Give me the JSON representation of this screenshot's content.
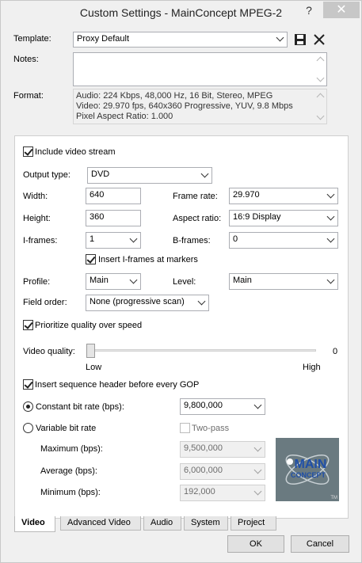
{
  "window": {
    "title": "Custom Settings - MainConcept MPEG-2"
  },
  "titlebar": {
    "help": "?",
    "close": "✕"
  },
  "template": {
    "label": "Template:",
    "value": "Proxy Default"
  },
  "notes": {
    "label": "Notes:",
    "value": ""
  },
  "format": {
    "label": "Format:",
    "lines": [
      "Audio: 224 Kbps, 48,000 Hz, 16 Bit, Stereo, MPEG",
      "Video: 29.970 fps, 640x360 Progressive, YUV, 9.8 Mbps",
      "Pixel Aspect Ratio: 1.000"
    ]
  },
  "video": {
    "include_stream": {
      "label": "Include video stream",
      "checked": true
    },
    "output_type": {
      "label": "Output type:",
      "value": "DVD"
    },
    "width": {
      "label": "Width:",
      "value": "640"
    },
    "height": {
      "label": "Height:",
      "value": "360"
    },
    "frame_rate": {
      "label": "Frame rate:",
      "value": "29.970"
    },
    "aspect_ratio": {
      "label": "Aspect ratio:",
      "value": "16:9 Display"
    },
    "iframes": {
      "label": "I-frames:",
      "value": "1"
    },
    "bframes": {
      "label": "B-frames:",
      "value": "0"
    },
    "insert_iframes": {
      "label": "Insert I-frames at markers",
      "checked": true
    },
    "profile": {
      "label": "Profile:",
      "value": "Main"
    },
    "level": {
      "label": "Level:",
      "value": "Main"
    },
    "field_order": {
      "label": "Field order:",
      "value": "None (progressive scan)"
    },
    "prioritize": {
      "label": "Prioritize quality over speed",
      "checked": true
    },
    "quality": {
      "label": "Video quality:",
      "value": "0",
      "low": "Low",
      "high": "High",
      "level": 0
    },
    "seq_header": {
      "label": "Insert sequence header before every GOP",
      "checked": true
    },
    "cbr": {
      "label": "Constant bit rate (bps):",
      "value": "9,800,000",
      "selected": true
    },
    "vbr": {
      "label": "Variable bit rate",
      "selected": false
    },
    "two_pass": {
      "label": "Two-pass",
      "checked": false
    },
    "maximum": {
      "label": "Maximum (bps):",
      "value": "9,500,000"
    },
    "average": {
      "label": "Average (bps):",
      "value": "6,000,000"
    },
    "minimum": {
      "label": "Minimum (bps):",
      "value": "192,000"
    },
    "logo": {
      "line1": "MAIN",
      "line2": "CONCEPT",
      "tm": "TM"
    }
  },
  "tabs": [
    {
      "label": "Video",
      "active": true
    },
    {
      "label": "Advanced Video",
      "active": false
    },
    {
      "label": "Audio",
      "active": false
    },
    {
      "label": "System",
      "active": false
    },
    {
      "label": "Project",
      "active": false
    }
  ],
  "buttons": {
    "ok": "OK",
    "cancel": "Cancel"
  },
  "colors": {
    "window_bg": "#f0f0f0",
    "panel_bg": "#ffffff",
    "logo_bg": "#6a7a80",
    "logo_text": "#1f4fa8"
  }
}
